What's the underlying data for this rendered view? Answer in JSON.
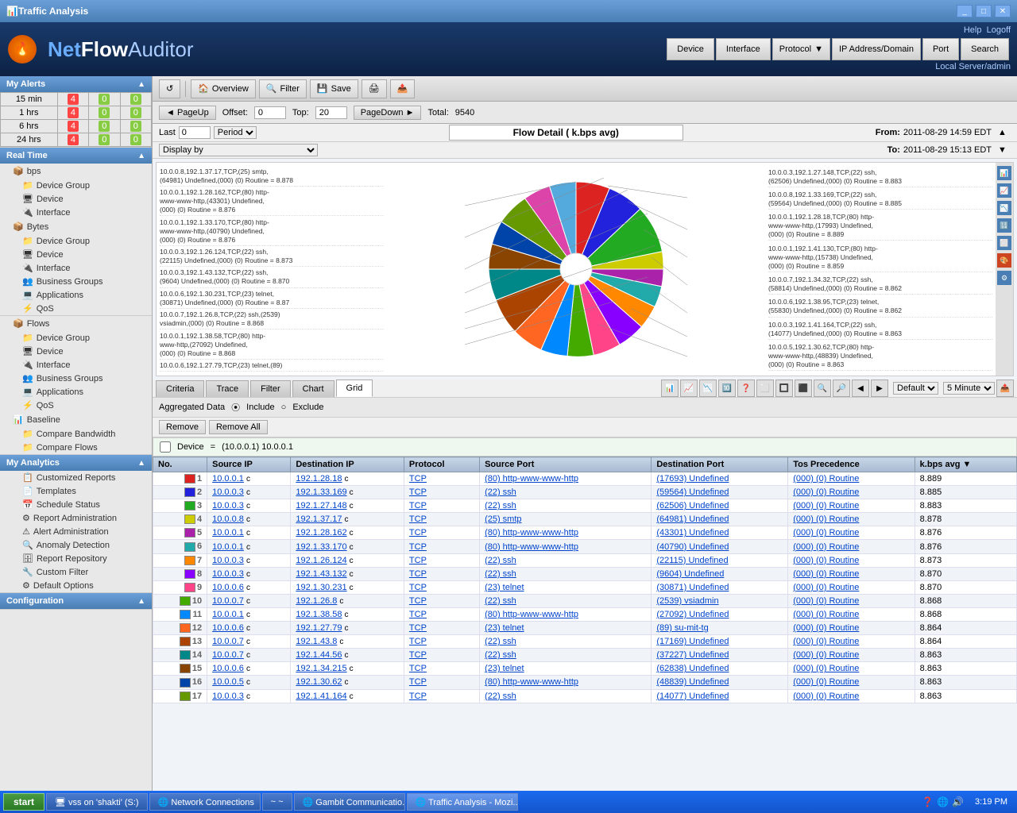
{
  "window": {
    "title": "Traffic Analysis",
    "icon": "📊"
  },
  "header": {
    "logo_net": "Net",
    "logo_flow": "Flow",
    "logo_auditor": "Auditor",
    "help": "Help",
    "logoff": "Logoff",
    "server": "Local Server/admin"
  },
  "nav": {
    "device": "Device",
    "interface": "Interface",
    "protocol": "Protocol",
    "ip_address": "IP Address/Domain",
    "port": "Port",
    "search": "Search"
  },
  "toolbar": {
    "refresh_label": "↺",
    "overview_label": "Overview",
    "filter_label": "Filter",
    "save_label": "Save",
    "icons": [
      "⟲",
      "📋",
      "🔍"
    ]
  },
  "pagination": {
    "page_up": "◄ PageUp",
    "page_down": "PageDown ►",
    "offset_label": "Offset:",
    "offset_value": "0",
    "top_label": "Top:",
    "top_value": "20",
    "total_label": "Total:",
    "total_value": "9540"
  },
  "time": {
    "title": "Flow Detail ( k.bps avg)",
    "last_label": "Last",
    "last_value": "0",
    "period_label": "Period",
    "display_by": "Display by",
    "from_label": "From:",
    "from_value": "2011-08-29 14:59 EDT",
    "to_label": "To:",
    "to_value": "2011-08-29 15:13 EDT"
  },
  "alerts": {
    "title": "My Alerts",
    "rows": [
      {
        "time": "15 min",
        "col1": 4,
        "col2": 0,
        "col3": 0
      },
      {
        "time": "1 hrs",
        "col1": 4,
        "col2": 0,
        "col3": 0
      },
      {
        "time": "6 hrs",
        "col1": 4,
        "col2": 0,
        "col3": 0
      },
      {
        "time": "24 hrs",
        "col1": 4,
        "col2": 0,
        "col3": 0
      }
    ]
  },
  "sidebar": {
    "realtime_title": "Real Time",
    "items_bps": [
      "Device Group",
      "Device",
      "Interface"
    ],
    "items_bytes": [
      "Device Group",
      "Device",
      "Interface",
      "Business Groups",
      "Applications",
      "QoS"
    ],
    "flows_title": "Flows",
    "flows_items": [
      "Device Group",
      "Device",
      "Interface",
      "Business Groups",
      "Applications",
      "QoS"
    ],
    "baseline_title": "Baseline",
    "baseline_items": [
      "Compare Bandwidth",
      "Compare Flows"
    ],
    "analytics_title": "My Analytics",
    "analytics_items": [
      "Customized Reports",
      "Templates",
      "Schedule Status",
      "Report Administration",
      "Alert Administration",
      "Anomaly Detection",
      "Report Repository",
      "Custom Filter",
      "Default Options"
    ],
    "config_title": "Configuration"
  },
  "chart": {
    "labels_left": [
      "10.0.0.8,192.1.37.17,TCP,(25) smtp, (64981) Undefined,(000) (0) Routine = 8.878",
      "10.0.0.1,192.1.28.162,TCP,(80) http- www-www-http,(43301) Undefined, (000) (0) Routine = 8.876",
      "10.0.0.1,192.1.33.170,TCP,(80) http- www-www-http,(40790) Undefined, (000) (0) Routine = 8.876",
      "10.0.0.3,192.1.26.124,TCP,(22) ssh, (22115) Undefined,(000) (0) Routine = 8.873",
      "10.0.0.3,192.1.43.132,TCP,(22) ssh, (9604) Undefined,(000) (0) Routine = 8.870",
      "10.0.0.6,192.1.30.231,TCP,(23) telnet, (30871) Undefined,(000) (0) Routine = 8.87",
      "10.0.0.7,192.1.26.8,TCP,(22) ssh,(2539) vsiadmin,(000) (0) Routine = 8.868",
      "10.0.0.1,192.1.38.58,TCP,(80) http- www-http,(27092) Undefined, (000) (0) Routine = 8.868",
      "10.0.0.6,192.1.27.79,TCP,(23) telnet,(89)"
    ],
    "labels_right": [
      "10.0.0.3,192.1.27.148,TCP,(22) ssh, (62506) Undefined,(000) (0) Routine = 8.883",
      "10.0.0.8,192.1.33.169,TCP,(22) ssh, (59564) Undefined,(000) (0) Routine = 8.885",
      "10.0.0.1,192.1.28.18,TCP,(80) http- www-www-http,(17993) Undefined, (000) (0) Routine = 8.889",
      "10.0.0.1,192.1.41.130,TCP,(80) http- www-www-http,(15738) Undefined, (000) (0) Routine = 8.859",
      "10.0.0.7,192.1.34.32,TCP,(22) ssh, (58814) Undefined,(000) (0) Routine = 8.862",
      "10.0.0.6,192.1.38.95,TCP,(23) telnet, (55830) Undefined,(000) (0) Routine = 8.862",
      "10.0.0.3,192.1.41.164,TCP,(22) ssh, (14077) Undefined,(000) (0) Routine = 8.863",
      "10.0.0.5,192.1.30.62,TCP,(80) http- www-www-http,(48839) Undefined, (000) (0) Routine = 8.863"
    ]
  },
  "tabs": {
    "criteria": "Criteria",
    "trace": "Trace",
    "filter": "Filter",
    "chart": "Chart",
    "grid": "Grid",
    "active": "Grid"
  },
  "filter": {
    "aggregated_label": "Aggregated Data",
    "include_label": "Include",
    "exclude_label": "Exclude",
    "remove_label": "Remove",
    "remove_all_label": "Remove All",
    "device_label": "Device",
    "equals": "=",
    "device_value": "(10.0.0.1) 10.0.0.1"
  },
  "table": {
    "headers": [
      "No.",
      "Source IP",
      "Destination IP",
      "Protocol",
      "Source Port",
      "Destination Port",
      "Tos Precedence",
      "k.bps avg ▼"
    ],
    "rows": [
      {
        "no": "1",
        "color": "#dd2222",
        "src_ip": "10.0.0.1",
        "dst_ip": "192.1.28.18",
        "proto": "TCP",
        "src_port": "(80) http-www-www-http",
        "dst_port": "(17693) Undefined",
        "tos": "(000) (0) Routine",
        "kbps": "8.889"
      },
      {
        "no": "2",
        "color": "#2222dd",
        "src_ip": "10.0.0.3",
        "dst_ip": "192.1.33.169",
        "proto": "TCP",
        "src_port": "(22) ssh",
        "dst_port": "(59564) Undefined",
        "tos": "(000) (0) Routine",
        "kbps": "8.885"
      },
      {
        "no": "3",
        "color": "#22aa22",
        "src_ip": "10.0.0.3",
        "dst_ip": "192.1.27.148",
        "proto": "TCP",
        "src_port": "(22) ssh",
        "dst_port": "(62506) Undefined",
        "tos": "(000) (0) Routine",
        "kbps": "8.883"
      },
      {
        "no": "4",
        "color": "#cccc00",
        "src_ip": "10.0.0.8",
        "dst_ip": "192.1.37.17",
        "proto": "TCP",
        "src_port": "(25) smtp",
        "dst_port": "(64981) Undefined",
        "tos": "(000) (0) Routine",
        "kbps": "8.878"
      },
      {
        "no": "5",
        "color": "#aa22aa",
        "src_ip": "10.0.0.1",
        "dst_ip": "192.1.28.162",
        "proto": "TCP",
        "src_port": "(80) http-www-www-http",
        "dst_port": "(43301) Undefined",
        "tos": "(000) (0) Routine",
        "kbps": "8.876"
      },
      {
        "no": "6",
        "color": "#22aaaa",
        "src_ip": "10.0.0.1",
        "dst_ip": "192.1.33.170",
        "proto": "TCP",
        "src_port": "(80) http-www-www-http",
        "dst_port": "(40790) Undefined",
        "tos": "(000) (0) Routine",
        "kbps": "8.876"
      },
      {
        "no": "7",
        "color": "#ff8800",
        "src_ip": "10.0.0.3",
        "dst_ip": "192.1.26.124",
        "proto": "TCP",
        "src_port": "(22) ssh",
        "dst_port": "(22115) Undefined",
        "tos": "(000) (0) Routine",
        "kbps": "8.873"
      },
      {
        "no": "8",
        "color": "#8800ff",
        "src_ip": "10.0.0.3",
        "dst_ip": "192.1.43.132",
        "proto": "TCP",
        "src_port": "(22) ssh",
        "dst_port": "(9604) Undefined",
        "tos": "(000) (0) Routine",
        "kbps": "8.870"
      },
      {
        "no": "9",
        "color": "#ff4488",
        "src_ip": "10.0.0.6",
        "dst_ip": "192.1.30.231",
        "proto": "TCP",
        "src_port": "(23) telnet",
        "dst_port": "(30871) Undefined",
        "tos": "(000) (0) Routine",
        "kbps": "8.870"
      },
      {
        "no": "10",
        "color": "#44aa00",
        "src_ip": "10.0.0.7",
        "dst_ip": "192.1.26.8",
        "proto": "TCP",
        "src_port": "(22) ssh",
        "dst_port": "(2539) vsiadmin",
        "tos": "(000) (0) Routine",
        "kbps": "8.868"
      },
      {
        "no": "11",
        "color": "#0088ff",
        "src_ip": "10.0.0.1",
        "dst_ip": "192.1.38.58",
        "proto": "TCP",
        "src_port": "(80) http-www-www-http",
        "dst_port": "(27092) Undefined",
        "tos": "(000) (0) Routine",
        "kbps": "8.868"
      },
      {
        "no": "12",
        "color": "#ff6622",
        "src_ip": "10.0.0.6",
        "dst_ip": "192.1.27.79",
        "proto": "TCP",
        "src_port": "(23) telnet",
        "dst_port": "(89) su-mit-tg",
        "tos": "(000) (0) Routine",
        "kbps": "8.864"
      },
      {
        "no": "13",
        "color": "#aa4400",
        "src_ip": "10.0.0.7",
        "dst_ip": "192.1.43.8",
        "proto": "TCP",
        "src_port": "(22) ssh",
        "dst_port": "(17169) Undefined",
        "tos": "(000) (0) Routine",
        "kbps": "8.864"
      },
      {
        "no": "14",
        "color": "#008888",
        "src_ip": "10.0.0.7",
        "dst_ip": "192.1.44.56",
        "proto": "TCP",
        "src_port": "(22) ssh",
        "dst_port": "(37227) Undefined",
        "tos": "(000) (0) Routine",
        "kbps": "8.863"
      },
      {
        "no": "15",
        "color": "#884400",
        "src_ip": "10.0.0.6",
        "dst_ip": "192.1.34.215",
        "proto": "TCP",
        "src_port": "(23) telnet",
        "dst_port": "(62838) Undefined",
        "tos": "(000) (0) Routine",
        "kbps": "8.863"
      },
      {
        "no": "16",
        "color": "#0044aa",
        "src_ip": "10.0.0.5",
        "dst_ip": "192.1.30.62",
        "proto": "TCP",
        "src_port": "(80) http-www-www-http",
        "dst_port": "(48839) Undefined",
        "tos": "(000) (0) Routine",
        "kbps": "8.863"
      },
      {
        "no": "17",
        "color": "#669900",
        "src_ip": "10.0.0.3",
        "dst_ip": "192.1.41.164",
        "proto": "TCP",
        "src_port": "(22) ssh",
        "dst_port": "(14077) Undefined",
        "tos": "(000) (0) Routine",
        "kbps": "8.863"
      }
    ]
  },
  "taskbar": {
    "start": "start",
    "items": [
      "vss on 'shakti' (S:)",
      "Network Connections",
      "~",
      "Gambit Communicatio...",
      "Traffic Analysis - Mozi..."
    ],
    "time": "3:19 PM"
  }
}
